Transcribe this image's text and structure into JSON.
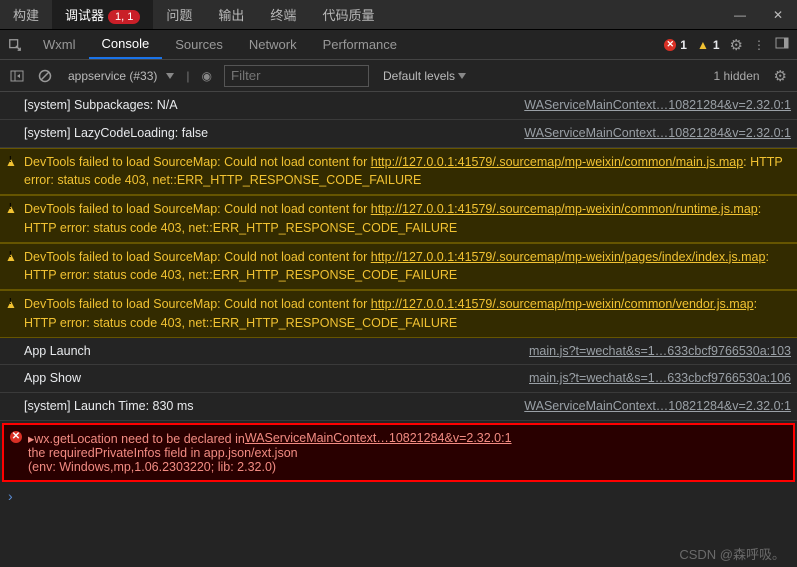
{
  "win": {
    "tabs": [
      "构建",
      "调试器",
      "问题",
      "输出",
      "终端",
      "代码质量"
    ],
    "debug_count": "1, 1",
    "min": "—",
    "close": "✕"
  },
  "tabs": [
    "Wxml",
    "Console",
    "Sources",
    "Network",
    "Performance"
  ],
  "badge": {
    "err": "1",
    "warn": "1"
  },
  "filter": {
    "context": "appservice (#33)",
    "placeholder": "Filter",
    "levels": "Default levels",
    "hidden": "1 hidden"
  },
  "logs": [
    {
      "t": "log",
      "msg": "[system] Subpackages: N/A",
      "src": "WAServiceMainContext…10821284&v=2.32.0:1"
    },
    {
      "t": "log",
      "msg": "[system] LazyCodeLoading: false",
      "src": "WAServiceMainContext…10821284&v=2.32.0:1"
    },
    {
      "t": "warn",
      "pre": "DevTools failed to load SourceMap: Could not load content for ",
      "url": "http://127.0.0.1:41579/.sourcemap/mp-weixin/common/main.js.map",
      "post": ": HTTP error: status code 403, net::ERR_HTTP_RESPONSE_CODE_FAILURE"
    },
    {
      "t": "warn",
      "pre": "DevTools failed to load SourceMap: Could not load content for ",
      "url": "http://127.0.0.1:41579/.sourcemap/mp-weixin/common/runtime.js.map",
      "post": ": HTTP error: status code 403, net::ERR_HTTP_RESPONSE_CODE_FAILURE"
    },
    {
      "t": "warn",
      "pre": "DevTools failed to load SourceMap: Could not load content for ",
      "url": "http://127.0.0.1:41579/.sourcemap/mp-weixin/pages/index/index.js.map",
      "post": ": HTTP error: status code 403, net::ERR_HTTP_RESPONSE_CODE_FAILURE"
    },
    {
      "t": "warn",
      "pre": "DevTools failed to load SourceMap: Could not load content for ",
      "url": "http://127.0.0.1:41579/.sourcemap/mp-weixin/common/vendor.js.map",
      "post": ": HTTP error: status code 403, net::ERR_HTTP_RESPONSE_CODE_FAILURE"
    },
    {
      "t": "log",
      "msg": "App Launch",
      "src": "main.js?t=wechat&s=1…633cbcf9766530a:103"
    },
    {
      "t": "log",
      "msg": "App Show",
      "src": "main.js?t=wechat&s=1…633cbcf9766530a:106"
    },
    {
      "t": "log",
      "msg": "[system] Launch Time: 830 ms",
      "src": "WAServiceMainContext…10821284&v=2.32.0:1"
    }
  ],
  "error": {
    "l1": "▸wx.getLocation need to be declared in",
    "src": "WAServiceMainContext…10821284&v=2.32.0:1",
    "l2": "the requiredPrivateInfos field in app.json/ext.json",
    "l3": "(env: Windows,mp,1.06.2303220; lib: 2.32.0)"
  },
  "watermark": "CSDN @森呼吸。"
}
